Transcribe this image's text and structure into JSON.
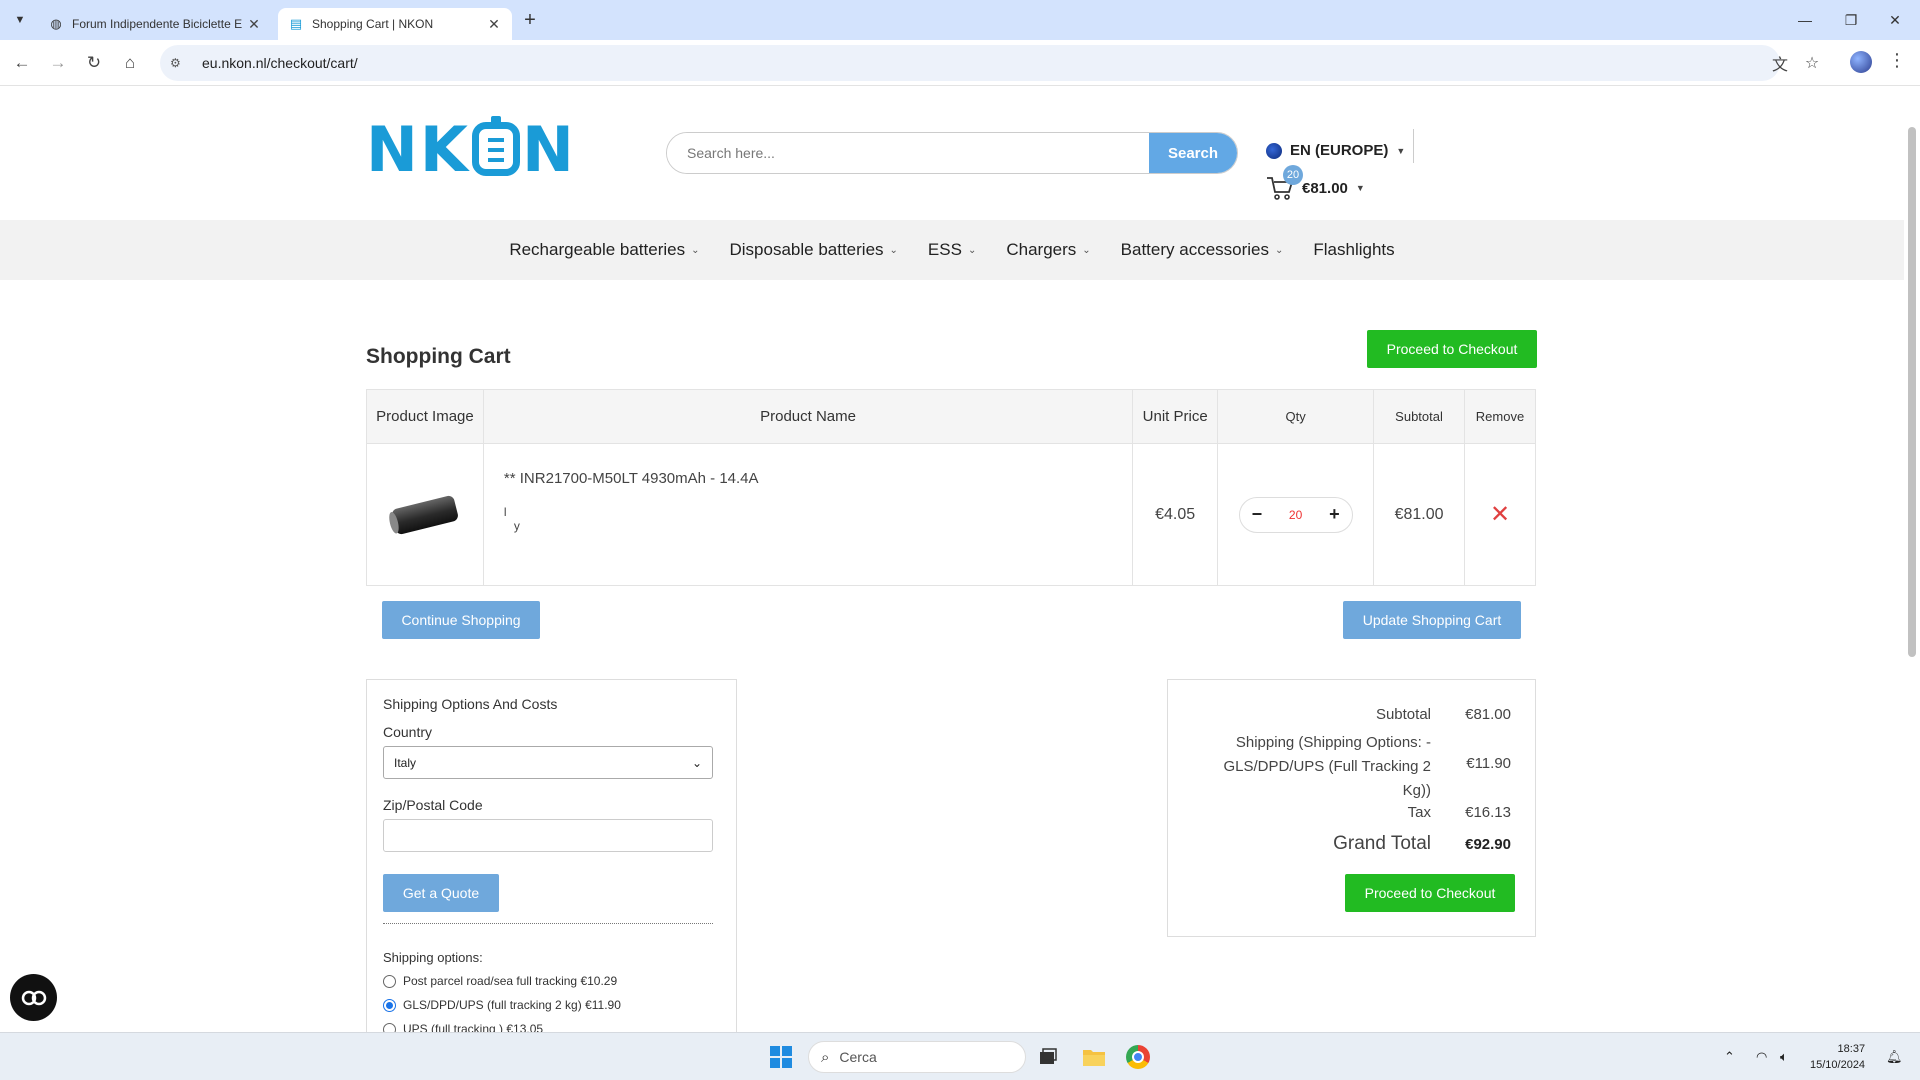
{
  "browser": {
    "tabs": [
      {
        "title": "Forum Indipendente Biciclette E",
        "active": false
      },
      {
        "title": "Shopping Cart | NKON",
        "active": true
      }
    ],
    "url": "eu.nkon.nl/checkout/cart/"
  },
  "header": {
    "logo_text": "NKON",
    "search_placeholder": "Search here...",
    "search_button": "Search",
    "language": "EN (EUROPE)",
    "cart_count": "20",
    "cart_total": "€81.00"
  },
  "nav": {
    "items": [
      {
        "label": "Rechargeable batteries",
        "has_dropdown": true
      },
      {
        "label": "Disposable batteries",
        "has_dropdown": true
      },
      {
        "label": "ESS",
        "has_dropdown": true
      },
      {
        "label": "Chargers",
        "has_dropdown": true
      },
      {
        "label": "Battery accessories",
        "has_dropdown": true
      },
      {
        "label": "Flashlights",
        "has_dropdown": false
      }
    ]
  },
  "cart": {
    "title": "Shopping Cart",
    "proceed_top": "Proceed to Checkout",
    "columns": [
      "Product Image",
      "Product Name",
      "Unit Price",
      "Qty",
      "Subtotal",
      "Remove"
    ],
    "items": [
      {
        "name": "** INR21700-M50LT 4930mAh - 14.4A",
        "option_line1": "l",
        "option_line2": "y",
        "unit_price": "€4.05",
        "qty": "20",
        "subtotal": "€81.00"
      }
    ],
    "continue_shopping": "Continue Shopping",
    "update_cart": "Update Shopping Cart"
  },
  "shipping": {
    "heading": "Shipping Options And Costs",
    "country_label": "Country",
    "country_value": "Italy",
    "zip_label": "Zip/Postal Code",
    "zip_value": "",
    "quote_button": "Get a Quote",
    "options_label": "Shipping options:",
    "options": [
      {
        "label": "Post parcel road/sea full tracking",
        "price": "€10.29",
        "selected": false
      },
      {
        "label": "GLS/DPD/UPS (full tracking 2 kg)",
        "price": "€11.90",
        "selected": true
      },
      {
        "label": "UPS (full tracking )",
        "price": "€13.05",
        "selected": false
      }
    ]
  },
  "totals": {
    "subtotal_label": "Subtotal",
    "subtotal_value": "€81.00",
    "shipping_label_1": "Shipping (Shipping Options: -",
    "shipping_label_2": "GLS/DPD/UPS (Full Tracking 2",
    "shipping_label_3": "Kg))",
    "shipping_value": "€11.90",
    "tax_label": "Tax",
    "tax_value": "€16.13",
    "grand_label": "Grand Total",
    "grand_value": "€92.90",
    "proceed_bottom": "Proceed to Checkout"
  },
  "taskbar": {
    "search_placeholder": "Cerca",
    "time": "18:37",
    "date": "15/10/2024"
  },
  "colors": {
    "brand": "#1a9bd7",
    "checkout_green": "#22bb22",
    "action_blue": "#6fa8dc"
  }
}
